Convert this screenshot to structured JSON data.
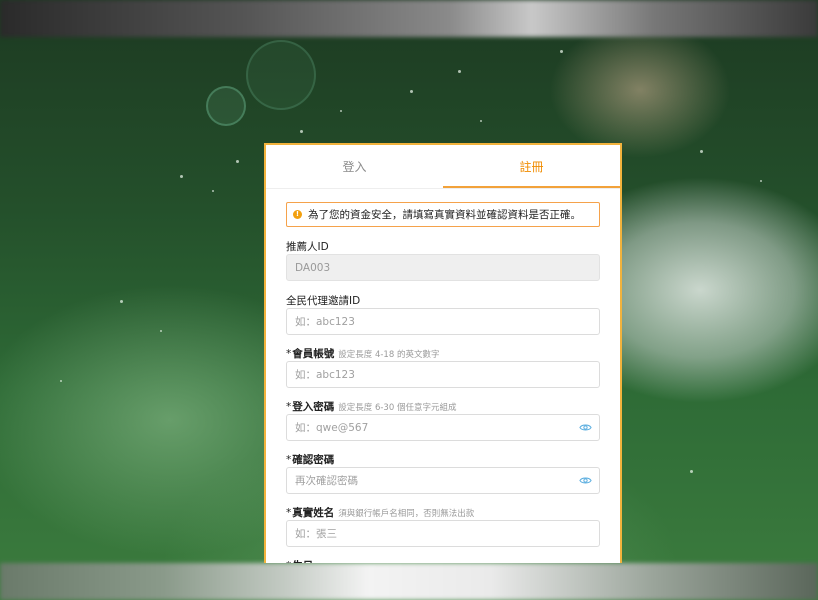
{
  "tabs": [
    {
      "label": "登入",
      "active": false
    },
    {
      "label": "註冊",
      "active": true
    }
  ],
  "notice": {
    "icon": "info-icon",
    "text": "為了您的資金安全，請填寫真實資料並確認資料是否正確。"
  },
  "form": {
    "referrer": {
      "label": "推薦人ID",
      "value": "DA003"
    },
    "agent_invite": {
      "label": "全民代理邀請ID",
      "placeholder": "如：abc123"
    },
    "account": {
      "required": "*",
      "label": "會員帳號",
      "hint": "設定長度 4-18 的英文數字",
      "placeholder": "如：abc123"
    },
    "password": {
      "required": "*",
      "label": "登入密碼",
      "hint": "設定長度 6-30 個任意字元組成",
      "placeholder": "如：qwe@567",
      "icon": "eye-icon"
    },
    "confirm_password": {
      "required": "*",
      "label": "確認密碼",
      "placeholder": "再次確認密碼",
      "icon": "eye-icon"
    },
    "real_name": {
      "required": "*",
      "label": "真實姓名",
      "hint": "須與銀行帳戶名相同，否則無法出款",
      "placeholder": "如：張三"
    },
    "birthday": {
      "required": "*",
      "label": "生日"
    }
  },
  "colors": {
    "accent": "#f08c00",
    "border": "#f2b33d"
  }
}
